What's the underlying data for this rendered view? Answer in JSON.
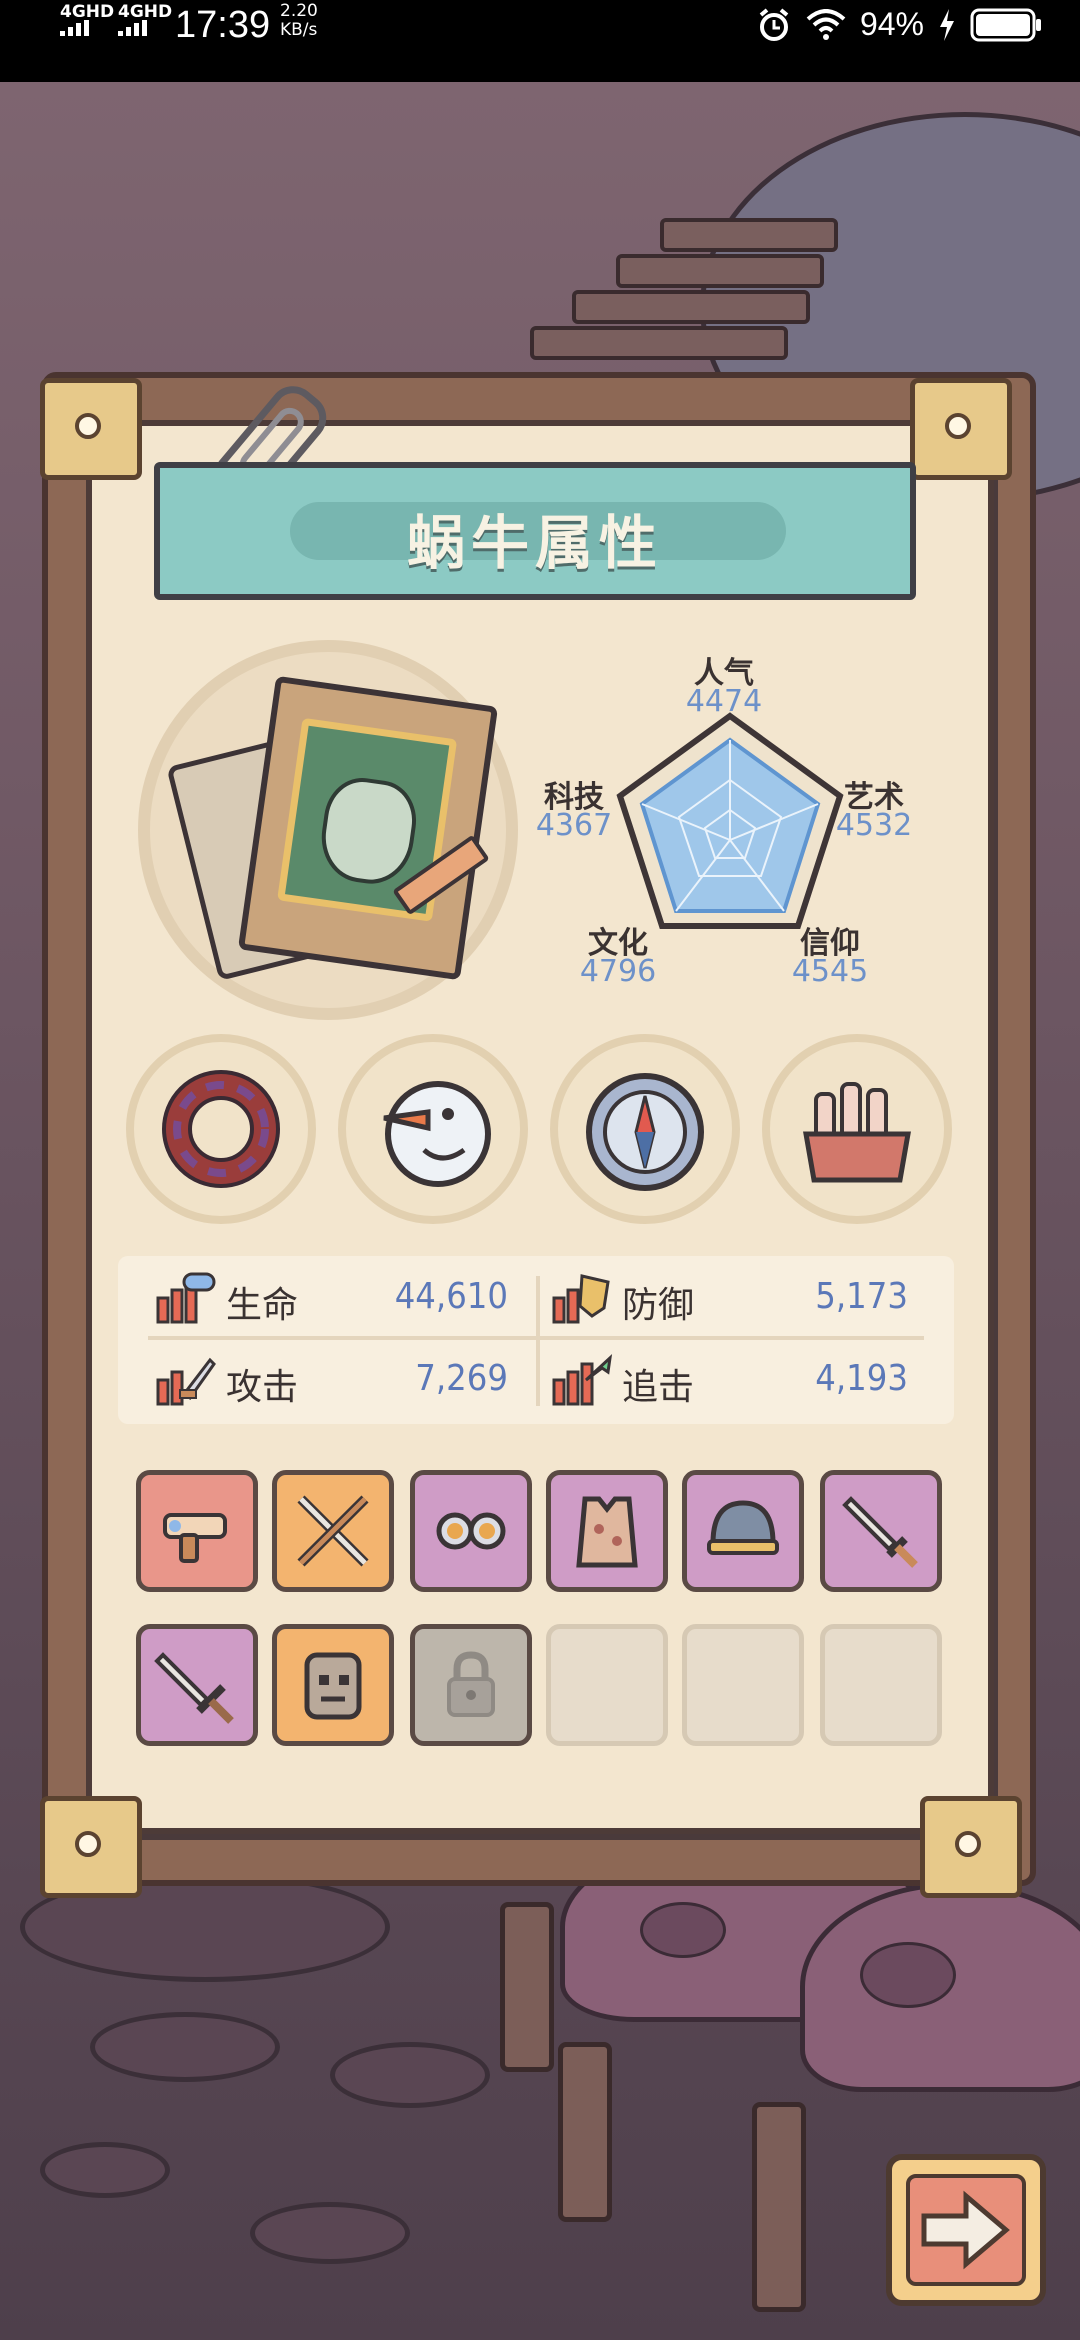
{
  "status_bar": {
    "network_1": "4GHD",
    "network_2": "4GHD",
    "time": "17:39",
    "speed_value": "2.20",
    "speed_unit": "KB/s",
    "battery": "94%"
  },
  "panel": {
    "title": "蜗牛属性"
  },
  "radar": {
    "stats": [
      {
        "label": "人气",
        "value": "4474"
      },
      {
        "label": "艺术",
        "value": "4532"
      },
      {
        "label": "信仰",
        "value": "4545"
      },
      {
        "label": "文化",
        "value": "4796"
      },
      {
        "label": "科技",
        "value": "4367"
      }
    ]
  },
  "attributes": [
    {
      "icon": "tentacle-ring-icon"
    },
    {
      "icon": "snowman-head-icon"
    },
    {
      "icon": "compass-icon"
    },
    {
      "icon": "potion-crate-icon"
    }
  ],
  "combat_stats": {
    "hp_label": "生命",
    "hp_value": "44,610",
    "defense_label": "防御",
    "defense_value": "5,173",
    "attack_label": "攻击",
    "attack_value": "7,269",
    "pursuit_label": "追击",
    "pursuit_value": "4,193"
  },
  "equipment": [
    {
      "icon": "blaster-gun-icon",
      "rarity": "red"
    },
    {
      "icon": "crossed-swords-icon",
      "rarity": "orange"
    },
    {
      "icon": "goggles-icon",
      "rarity": "purple"
    },
    {
      "icon": "armor-vest-icon",
      "rarity": "purple"
    },
    {
      "icon": "helmet-icon",
      "rarity": "purple"
    },
    {
      "icon": "dagger-icon",
      "rarity": "purple"
    },
    {
      "icon": "short-sword-icon",
      "rarity": "purple"
    },
    {
      "icon": "wooden-totem-icon",
      "rarity": "orange"
    },
    {
      "icon": "lock-icon",
      "rarity": "locked"
    },
    {
      "icon": "empty-slot",
      "rarity": "empty"
    },
    {
      "icon": "empty-slot",
      "rarity": "empty"
    },
    {
      "icon": "empty-slot",
      "rarity": "empty"
    }
  ],
  "next_button": {
    "icon": "right-arrow-icon"
  }
}
